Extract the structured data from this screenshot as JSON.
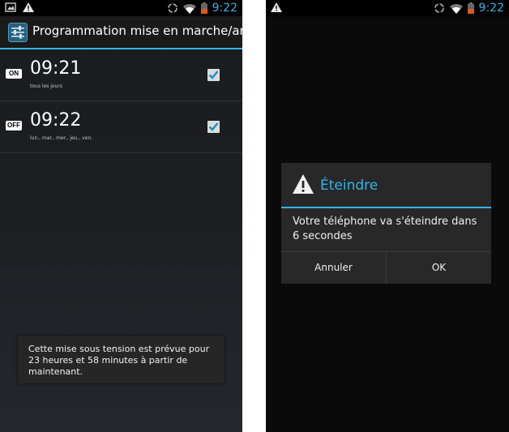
{
  "left_screen": {
    "status_bar": {
      "time": "9:22",
      "icons": [
        "image-icon",
        "warning-icon",
        "sync-icon",
        "wifi-icon",
        "battery-low-icon"
      ]
    },
    "action_bar": {
      "title": "Programmation mise en marche/arrêt",
      "icon": "settings-sliders-icon"
    },
    "schedules": [
      {
        "badge": "ON",
        "time": "09:21",
        "days": "tous les jours",
        "checked": true
      },
      {
        "badge": "OFF",
        "time": "09:22",
        "days": "lun., mar., mer., jeu., ven.",
        "checked": true
      }
    ],
    "toast": {
      "message": "Cette mise sous tension est prévue pour 23 heures et  58 minutes à partir de maintenant."
    }
  },
  "right_screen": {
    "status_bar": {
      "time": "9:22",
      "icons": [
        "warning-icon",
        "sync-icon",
        "wifi-icon",
        "battery-low-icon"
      ]
    },
    "dialog": {
      "icon": "warning-icon",
      "title": "Éteindre",
      "message": "Votre téléphone va s'éteindre dans 6 secondes",
      "cancel_label": "Annuler",
      "ok_label": "OK"
    }
  },
  "colors": {
    "accent": "#33b5e5",
    "battery": "#e05a1c"
  }
}
